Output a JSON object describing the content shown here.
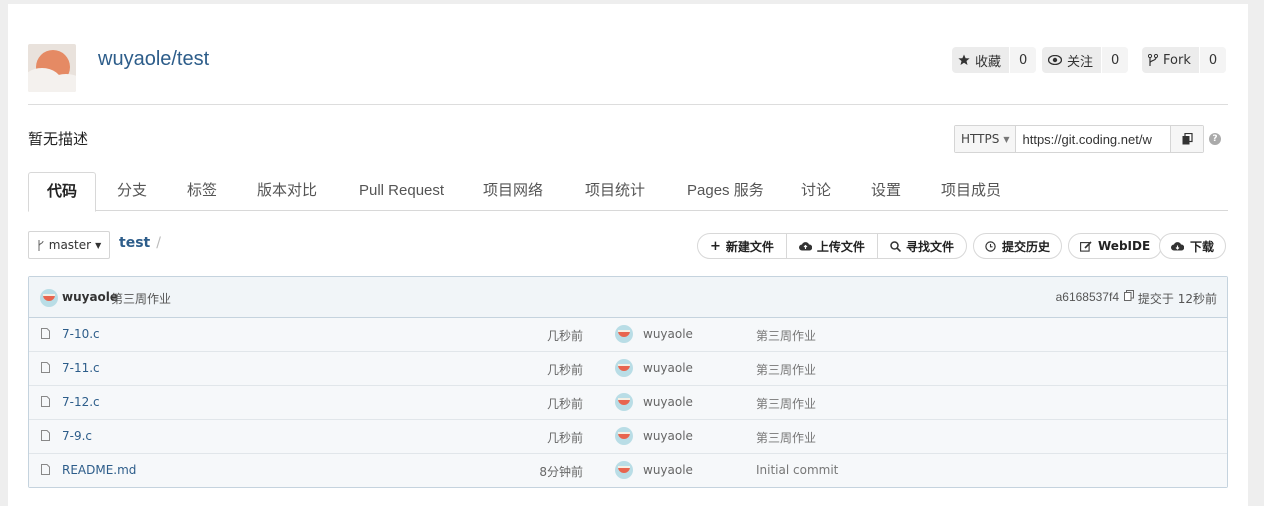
{
  "repo": {
    "title": "wuyaole/test",
    "description": "暂无描述"
  },
  "stats": {
    "star_label": "收藏",
    "star_count": "0",
    "watch_label": "关注",
    "watch_count": "0",
    "fork_label": "Fork",
    "fork_count": "0"
  },
  "clone": {
    "protocol": "HTTPS",
    "url": "https://git.coding.net/w"
  },
  "tabs": [
    {
      "label": "代码",
      "active": true
    },
    {
      "label": "分支"
    },
    {
      "label": "标签"
    },
    {
      "label": "版本对比"
    },
    {
      "label": "Pull Request"
    },
    {
      "label": "项目网络"
    },
    {
      "label": "项目统计"
    },
    {
      "label": "Pages 服务"
    },
    {
      "label": "讨论"
    },
    {
      "label": "设置"
    },
    {
      "label": "项目成员"
    }
  ],
  "branch": {
    "name": "master"
  },
  "path": {
    "root": "test",
    "sep": "/"
  },
  "toolbar": {
    "new_file": "新建文件",
    "upload_file": "上传文件",
    "find_file": "寻找文件",
    "history": "提交历史",
    "webide": "WebIDE",
    "download": "下载"
  },
  "last_commit": {
    "author": "wuyaole",
    "message": "第三周作业",
    "hash": "a6168537f4",
    "when": "提交于 12秒前"
  },
  "files": [
    {
      "name": "7-10.c",
      "time": "几秒前",
      "author": "wuyaole",
      "message": "第三周作业"
    },
    {
      "name": "7-11.c",
      "time": "几秒前",
      "author": "wuyaole",
      "message": "第三周作业"
    },
    {
      "name": "7-12.c",
      "time": "几秒前",
      "author": "wuyaole",
      "message": "第三周作业"
    },
    {
      "name": "7-9.c",
      "time": "几秒前",
      "author": "wuyaole",
      "message": "第三周作业"
    },
    {
      "name": "README.md",
      "time": "8分钟前",
      "author": "wuyaole",
      "message": "Initial commit"
    }
  ],
  "colors": {
    "link": "#2d5d8a",
    "table_border": "#c5d3de",
    "avatar_sun": "#e58a64"
  }
}
